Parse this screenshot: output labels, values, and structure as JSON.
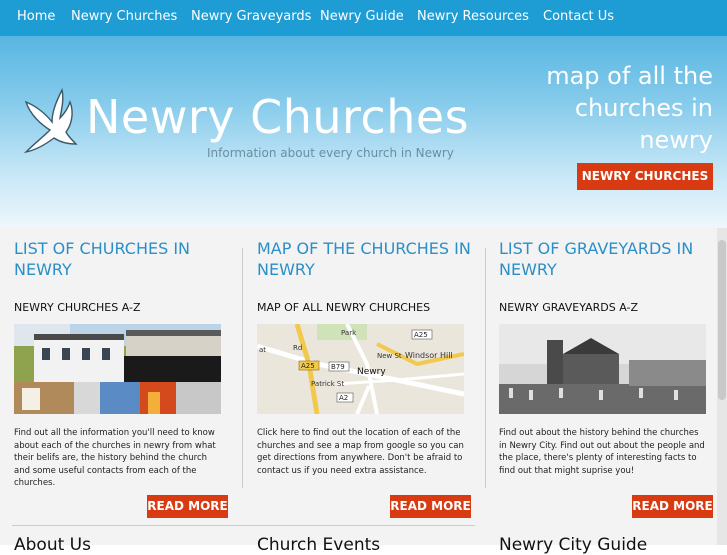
{
  "nav": {
    "items": [
      {
        "label": "Home"
      },
      {
        "label": "Newry Churches"
      },
      {
        "label": "Newry Graveyards"
      },
      {
        "label": "Newry Guide"
      },
      {
        "label": "Newry Resources"
      },
      {
        "label": "Contact Us"
      }
    ]
  },
  "header": {
    "title": "Newry Churches",
    "tagline": "Information about every church in Newry",
    "promo_text": "map of all the churches in newry",
    "promo_button": "NEWRY CHURCHES"
  },
  "columns": [
    {
      "heading": "LIST OF CHURCHES IN NEWRY",
      "subheading": "NEWRY CHURCHES A-Z",
      "description": "Find out all the information you'll need to know about each of the churches in newry from what their belifs are, the history behind the church and some useful contacts from each of the churches.",
      "button": "READ MORE"
    },
    {
      "heading": "MAP OF THE CHURCHES IN NEWRY",
      "subheading": "MAP OF ALL NEWRY CHURCHES",
      "description": "Click here to find out the location of each of the churches and see a map from google so you can get directions from anywhere. Don't be afraid to contact us if you need extra assistance.",
      "button": "READ MORE",
      "map_labels": {
        "park": "Park",
        "road": "Rd",
        "a25_top": "A25",
        "windsor": "Windsor Hill",
        "new_st": "New St",
        "a25_left": "A25",
        "b79": "B79",
        "newry": "Newry",
        "patrick": "Patrick St",
        "a2": "A2",
        "at": "at"
      }
    },
    {
      "heading": "LIST OF GRAVEYARDS IN NEWRY",
      "subheading": "NEWRY GRAVEYARDS A-Z",
      "description": "Find out about the history behind the churches in Newry City. Find out out about the people and the place, there's plenty of interesting facts to find out that might suprise you!",
      "button": "READ MORE"
    }
  ],
  "footer_headings": [
    "About Us",
    "Church Events",
    "Newry City Guide"
  ],
  "colors": {
    "nav_bg": "#1e9cd4",
    "accent": "#d83b12",
    "heading": "#2a8fc9"
  }
}
